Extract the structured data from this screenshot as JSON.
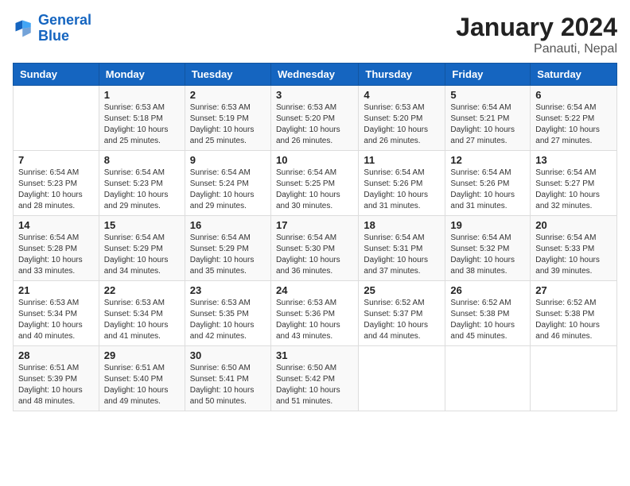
{
  "logo": {
    "line1": "General",
    "line2": "Blue"
  },
  "title": "January 2024",
  "subtitle": "Panauti, Nepal",
  "days_of_week": [
    "Sunday",
    "Monday",
    "Tuesday",
    "Wednesday",
    "Thursday",
    "Friday",
    "Saturday"
  ],
  "weeks": [
    [
      {
        "day": "",
        "info": ""
      },
      {
        "day": "1",
        "info": "Sunrise: 6:53 AM\nSunset: 5:18 PM\nDaylight: 10 hours\nand 25 minutes."
      },
      {
        "day": "2",
        "info": "Sunrise: 6:53 AM\nSunset: 5:19 PM\nDaylight: 10 hours\nand 25 minutes."
      },
      {
        "day": "3",
        "info": "Sunrise: 6:53 AM\nSunset: 5:20 PM\nDaylight: 10 hours\nand 26 minutes."
      },
      {
        "day": "4",
        "info": "Sunrise: 6:53 AM\nSunset: 5:20 PM\nDaylight: 10 hours\nand 26 minutes."
      },
      {
        "day": "5",
        "info": "Sunrise: 6:54 AM\nSunset: 5:21 PM\nDaylight: 10 hours\nand 27 minutes."
      },
      {
        "day": "6",
        "info": "Sunrise: 6:54 AM\nSunset: 5:22 PM\nDaylight: 10 hours\nand 27 minutes."
      }
    ],
    [
      {
        "day": "7",
        "info": "Sunrise: 6:54 AM\nSunset: 5:23 PM\nDaylight: 10 hours\nand 28 minutes."
      },
      {
        "day": "8",
        "info": "Sunrise: 6:54 AM\nSunset: 5:23 PM\nDaylight: 10 hours\nand 29 minutes."
      },
      {
        "day": "9",
        "info": "Sunrise: 6:54 AM\nSunset: 5:24 PM\nDaylight: 10 hours\nand 29 minutes."
      },
      {
        "day": "10",
        "info": "Sunrise: 6:54 AM\nSunset: 5:25 PM\nDaylight: 10 hours\nand 30 minutes."
      },
      {
        "day": "11",
        "info": "Sunrise: 6:54 AM\nSunset: 5:26 PM\nDaylight: 10 hours\nand 31 minutes."
      },
      {
        "day": "12",
        "info": "Sunrise: 6:54 AM\nSunset: 5:26 PM\nDaylight: 10 hours\nand 31 minutes."
      },
      {
        "day": "13",
        "info": "Sunrise: 6:54 AM\nSunset: 5:27 PM\nDaylight: 10 hours\nand 32 minutes."
      }
    ],
    [
      {
        "day": "14",
        "info": "Sunrise: 6:54 AM\nSunset: 5:28 PM\nDaylight: 10 hours\nand 33 minutes."
      },
      {
        "day": "15",
        "info": "Sunrise: 6:54 AM\nSunset: 5:29 PM\nDaylight: 10 hours\nand 34 minutes."
      },
      {
        "day": "16",
        "info": "Sunrise: 6:54 AM\nSunset: 5:29 PM\nDaylight: 10 hours\nand 35 minutes."
      },
      {
        "day": "17",
        "info": "Sunrise: 6:54 AM\nSunset: 5:30 PM\nDaylight: 10 hours\nand 36 minutes."
      },
      {
        "day": "18",
        "info": "Sunrise: 6:54 AM\nSunset: 5:31 PM\nDaylight: 10 hours\nand 37 minutes."
      },
      {
        "day": "19",
        "info": "Sunrise: 6:54 AM\nSunset: 5:32 PM\nDaylight: 10 hours\nand 38 minutes."
      },
      {
        "day": "20",
        "info": "Sunrise: 6:54 AM\nSunset: 5:33 PM\nDaylight: 10 hours\nand 39 minutes."
      }
    ],
    [
      {
        "day": "21",
        "info": "Sunrise: 6:53 AM\nSunset: 5:34 PM\nDaylight: 10 hours\nand 40 minutes."
      },
      {
        "day": "22",
        "info": "Sunrise: 6:53 AM\nSunset: 5:34 PM\nDaylight: 10 hours\nand 41 minutes."
      },
      {
        "day": "23",
        "info": "Sunrise: 6:53 AM\nSunset: 5:35 PM\nDaylight: 10 hours\nand 42 minutes."
      },
      {
        "day": "24",
        "info": "Sunrise: 6:53 AM\nSunset: 5:36 PM\nDaylight: 10 hours\nand 43 minutes."
      },
      {
        "day": "25",
        "info": "Sunrise: 6:52 AM\nSunset: 5:37 PM\nDaylight: 10 hours\nand 44 minutes."
      },
      {
        "day": "26",
        "info": "Sunrise: 6:52 AM\nSunset: 5:38 PM\nDaylight: 10 hours\nand 45 minutes."
      },
      {
        "day": "27",
        "info": "Sunrise: 6:52 AM\nSunset: 5:38 PM\nDaylight: 10 hours\nand 46 minutes."
      }
    ],
    [
      {
        "day": "28",
        "info": "Sunrise: 6:51 AM\nSunset: 5:39 PM\nDaylight: 10 hours\nand 48 minutes."
      },
      {
        "day": "29",
        "info": "Sunrise: 6:51 AM\nSunset: 5:40 PM\nDaylight: 10 hours\nand 49 minutes."
      },
      {
        "day": "30",
        "info": "Sunrise: 6:50 AM\nSunset: 5:41 PM\nDaylight: 10 hours\nand 50 minutes."
      },
      {
        "day": "31",
        "info": "Sunrise: 6:50 AM\nSunset: 5:42 PM\nDaylight: 10 hours\nand 51 minutes."
      },
      {
        "day": "",
        "info": ""
      },
      {
        "day": "",
        "info": ""
      },
      {
        "day": "",
        "info": ""
      }
    ]
  ]
}
